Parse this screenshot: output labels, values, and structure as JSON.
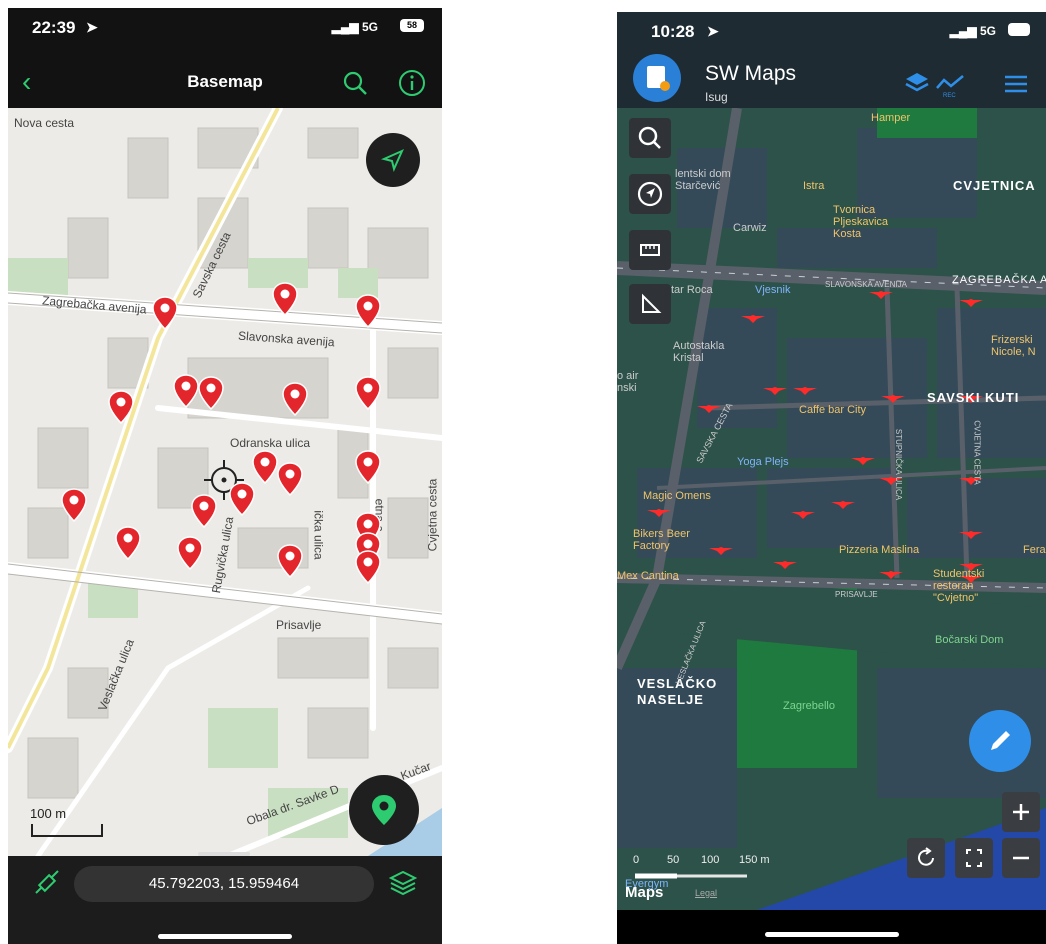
{
  "left": {
    "status": {
      "time": "22:39",
      "signal": "5G",
      "battery": "58"
    },
    "nav": {
      "title": "Basemap"
    },
    "map": {
      "labels": {
        "nova_cesta": "Nova cesta",
        "zagrebacka": "Zagrebačka avenija",
        "savska": "Savska cesta",
        "slavonska": "Slavonska avenija",
        "odranska": "Odranska ulica",
        "prisavlje": "Prisavlje",
        "cvjetna": "Cvjetna cesta",
        "veslacka": "Veslačka ulica",
        "rugvicka": "Rugvička ulica",
        "kucar": "Kučar",
        "obala": "Obala dr. Savke D",
        "ulica2": "ička ulica",
        "ulica3": "etna c"
      },
      "scale": "100 m"
    },
    "bottom": {
      "coordinates": "45.792203, 15.959464"
    }
  },
  "right": {
    "status": {
      "time": "10:28",
      "signal": "5G"
    },
    "header": {
      "app_title": "SW Maps",
      "subtitle": "Isug"
    },
    "map": {
      "labels": {
        "hamper": "Hamper",
        "kentski": "lentski dom",
        "starcevic": "Starčević",
        "istra": "Istra",
        "cvjetnica": "CVJETNICA",
        "tvornica": "Tvornica Pljeskavica Kosta",
        "carwiz": "Carwiz",
        "vjesnik": "Vjesnik",
        "zagrebacka": "ZAGREBAČKA A",
        "slavonska": "SLAVONSKA AVENIJA",
        "tar_roca": "tar Roca",
        "autostakla": "Autostakla Kristal",
        "frizerski": "Frizerski Nicole, N",
        "air": "o air nski",
        "caffe": "Caffe bar City",
        "savski": "SAVSKI KUTI",
        "savska": "SAVSKA CESTA",
        "yoga": "Yoga Plejs",
        "magic": "Magic Omens",
        "bikers": "Bikers Beer Factory",
        "pizzeria": "Pizzeria Maslina",
        "fera": "Fera",
        "studentski": "Studentski restoran \"Cvjetno\"",
        "mex": "Mex Cantina",
        "prisavlje": "PRISAVLJE",
        "bocarski": "Bočarski Dom",
        "veslacko": "VESLAČKO NASELJE",
        "zagrebello": "Zagrebello",
        "veslacka": "VESLAČKA ULICA",
        "stupnicka": "STUPNIČKA ULICA",
        "cvjetna": "CVJETNA CESTA"
      },
      "scale": {
        "s0": "0",
        "s50": "50",
        "s100": "100",
        "s150": "150 m"
      },
      "attribution": {
        "maps": "Maps",
        "legal": "Legal",
        "evergym": "Evergym"
      }
    }
  }
}
